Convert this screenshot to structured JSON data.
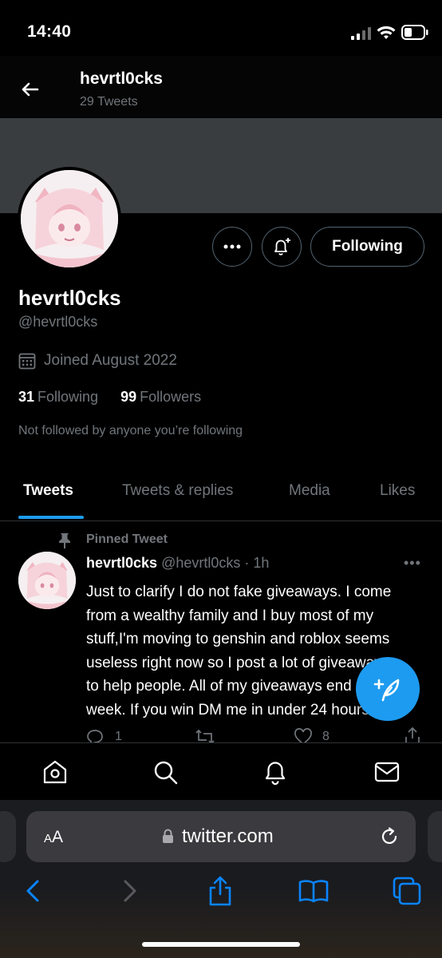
{
  "status_bar": {
    "time": "14:40"
  },
  "header": {
    "name": "hevrtl0cks",
    "tweet_count": "29 Tweets"
  },
  "profile": {
    "name": "hevrtl0cks",
    "handle": "@hevrtl0cks",
    "joined": "Joined August 2022",
    "following_count": "31",
    "following_label": "Following",
    "followers_count": "99",
    "followers_label": "Followers",
    "follow_context": "Not followed by anyone you’re following",
    "follow_button_label": "Following"
  },
  "tabs": [
    {
      "label": "Tweets",
      "active": true
    },
    {
      "label": "Tweets & replies",
      "active": false
    },
    {
      "label": "Media",
      "active": false
    },
    {
      "label": "Likes",
      "active": false
    }
  ],
  "pinned_tweet": {
    "pinned_label": "Pinned Tweet",
    "author_name": "hevrtl0cks",
    "author_handle": "@hevrtl0cks",
    "time": "· 1h",
    "more": "•••",
    "lines": [
      "Just to clarify I do not fake giveaways. I come",
      "from a wealthy family and I buy most of my",
      "stuff,I'm moving to genshin and roblox seems",
      "useless right now so I post a lot of giveaways",
      "to help people. All of my giveaways end every",
      "week. If you win DM me in under 24 hours"
    ],
    "reply_count": "1",
    "like_count": "8"
  },
  "bottom_nav": [
    "home-icon",
    "search-icon",
    "notifications-icon",
    "messages-icon"
  ],
  "safari": {
    "aa_label": "A",
    "aa_label_big": "A",
    "url": "twitter.com"
  },
  "colors": {
    "accent": "#1d9bf0",
    "background": "#000000",
    "secondary_text": "#71767b",
    "banner": "#3a3d40"
  }
}
